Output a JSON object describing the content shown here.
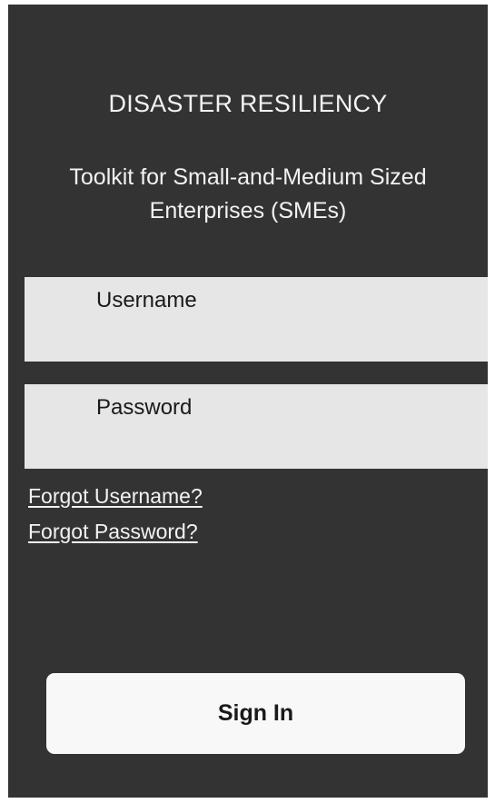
{
  "header": {
    "title": "DISASTER RESILIENCY",
    "subtitle": "Toolkit for Small-and-Medium Sized Enterprises (SMEs)"
  },
  "form": {
    "username_label": "Username",
    "password_label": "Password",
    "forgot_username": "Forgot Username?",
    "forgot_password": "Forgot Password?",
    "sign_in_label": "Sign In"
  },
  "colors": {
    "background": "#333333",
    "field": "#e6e6e6",
    "button": "#f8f8f8",
    "text_light": "#f2f2f2"
  }
}
